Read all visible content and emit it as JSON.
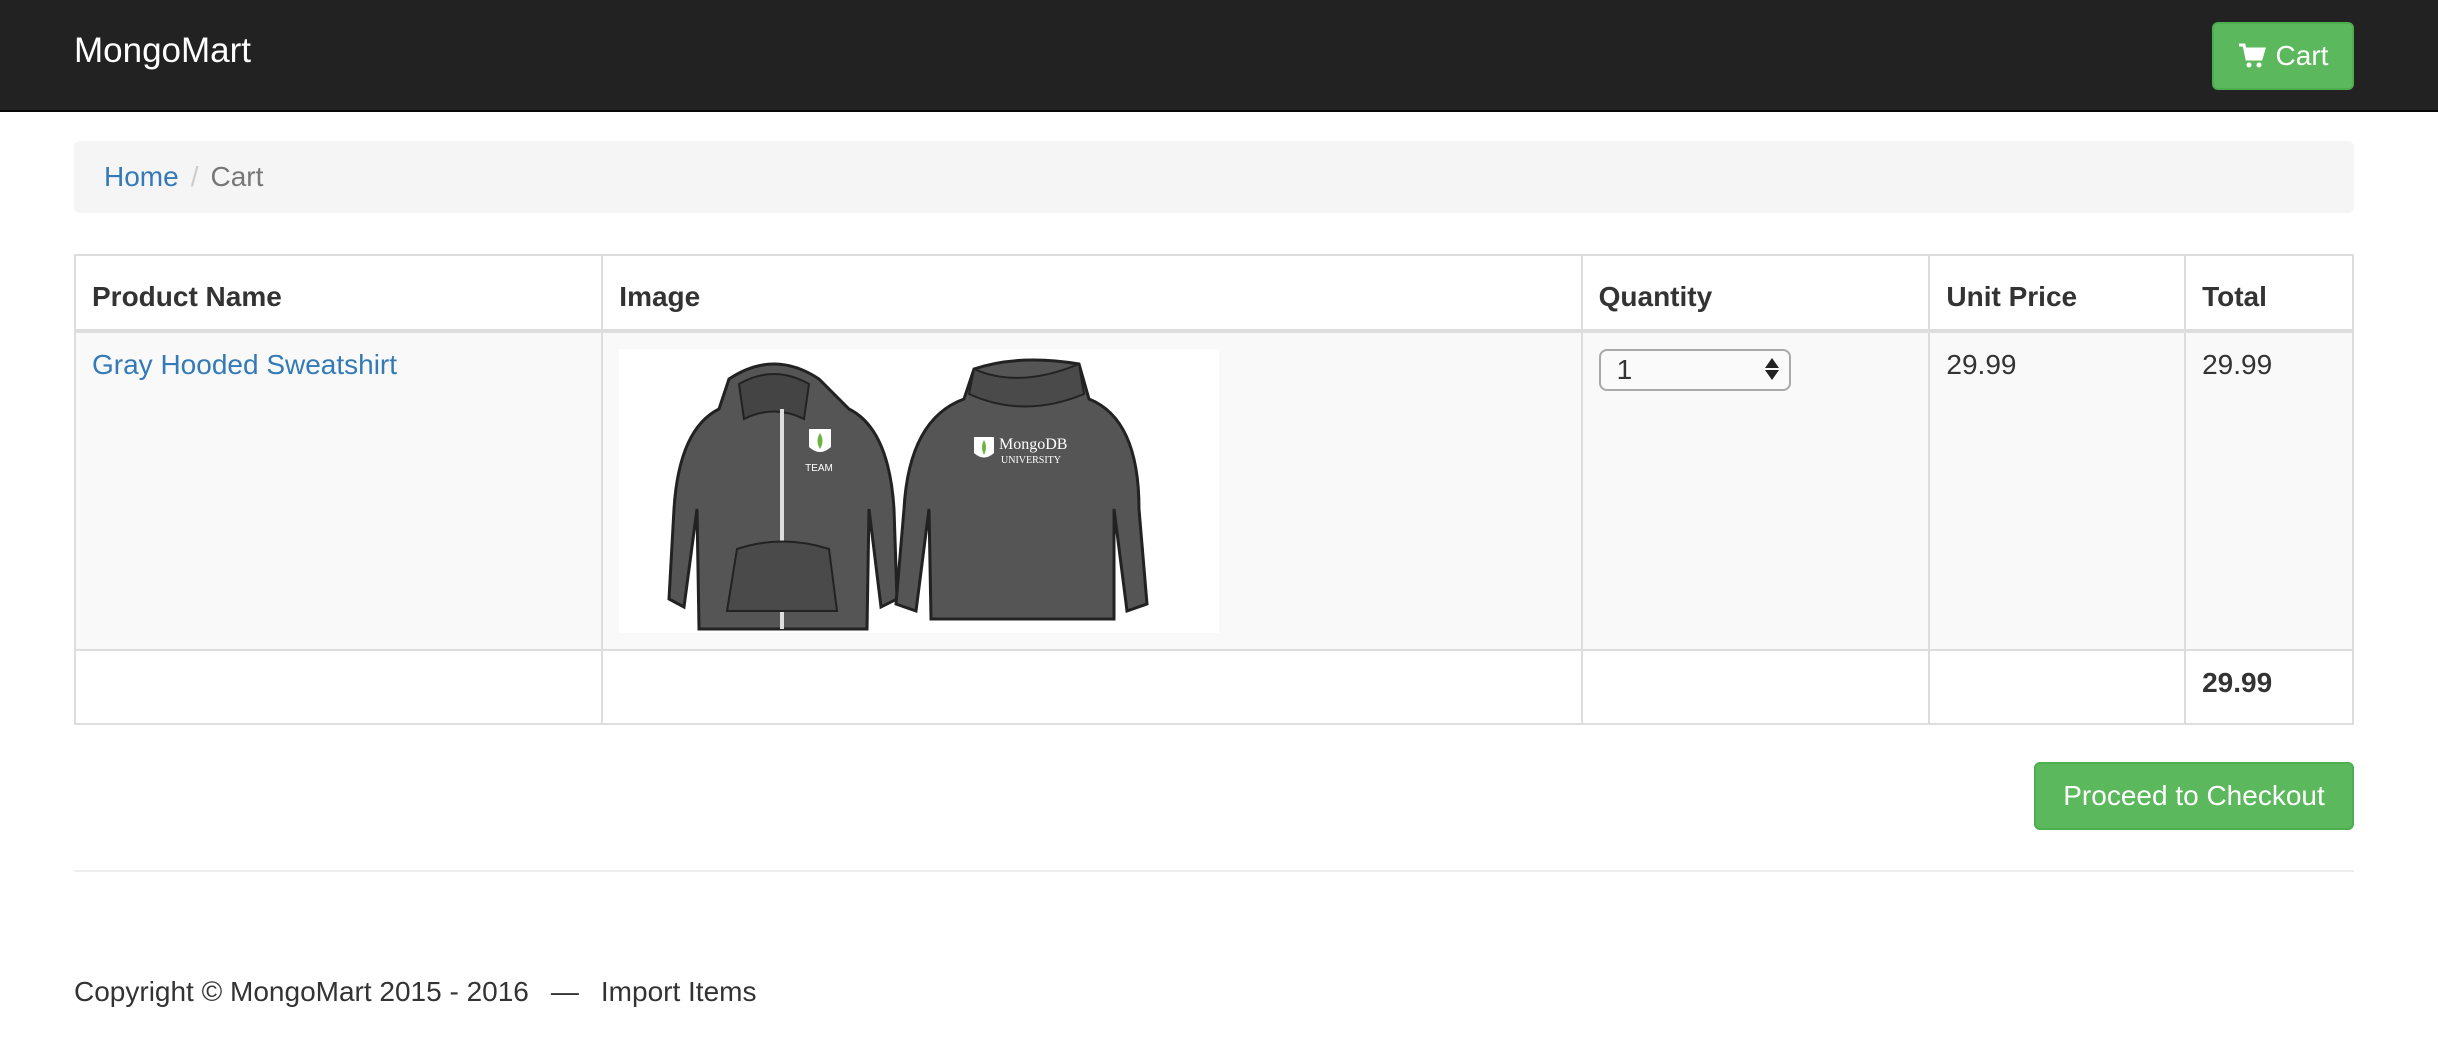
{
  "navbar": {
    "brand": "MongoMart",
    "cart_label": "Cart",
    "cart_icon": "shopping-cart-icon",
    "bg_color": "#222222",
    "accent_color": "#5cb85c"
  },
  "breadcrumb": {
    "home": "Home",
    "separator": "/",
    "current": "Cart"
  },
  "table": {
    "headers": [
      "Product Name",
      "Image",
      "Quantity",
      "Unit Price",
      "Total"
    ],
    "items": [
      {
        "name": "Gray Hooded Sweatshirt",
        "quantity": "1",
        "unit_price": "29.99",
        "total": "29.99",
        "image_badge_front": "TEAM",
        "image_badge_back_1": "MongoDB",
        "image_badge_back_2": "UNIVERSITY"
      }
    ],
    "grand_total": "29.99"
  },
  "checkout_label": "Proceed to Checkout",
  "footer": {
    "copyright": "Copyright © MongoMart 2015 - 2016",
    "dash": "—",
    "import_link": "Import Items"
  }
}
